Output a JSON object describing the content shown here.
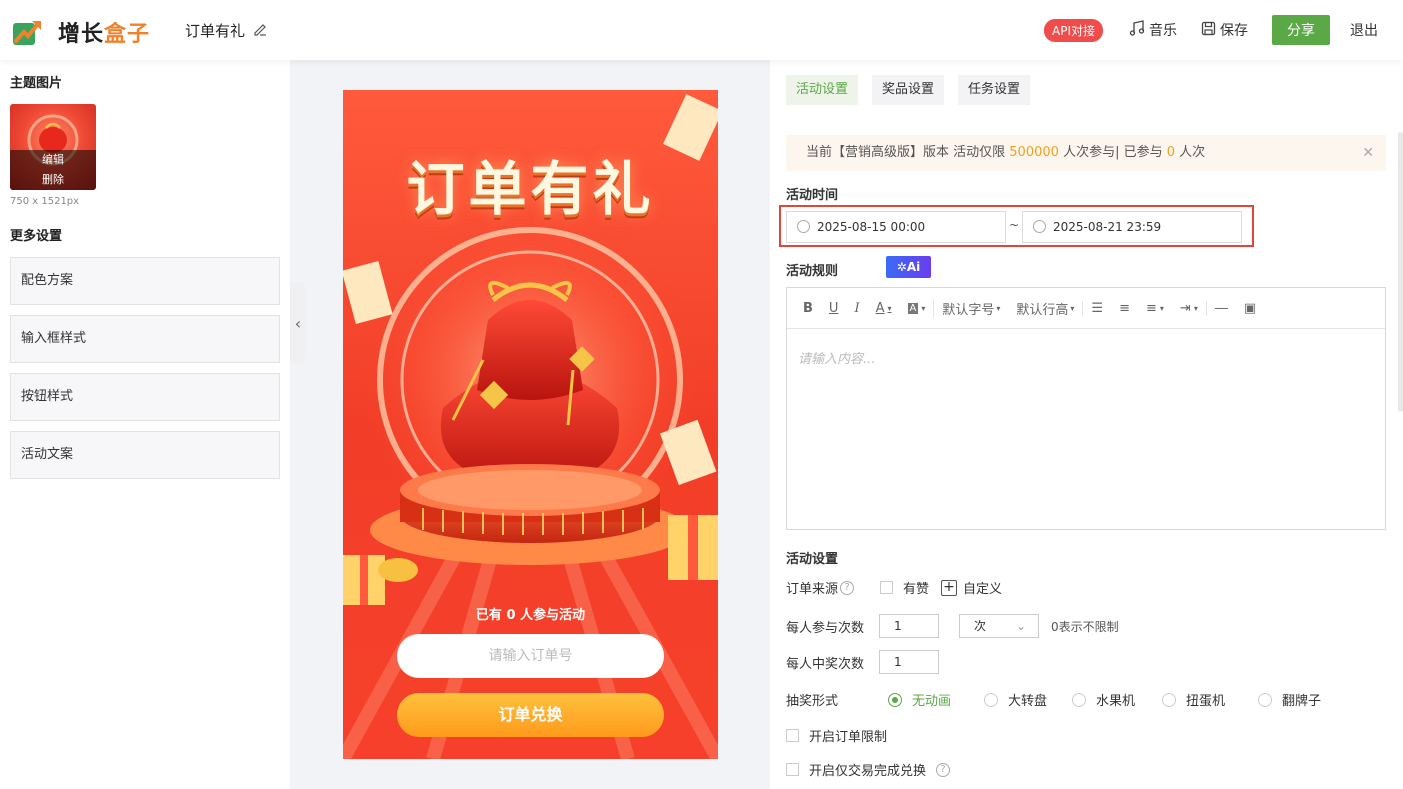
{
  "app": {
    "logo_part1": "增长",
    "logo_part2": "盒子",
    "page_title": "订单有礼"
  },
  "topbar": {
    "api_badge": "API对接",
    "music": "音乐",
    "save": "保存",
    "share": "分享",
    "exit": "退出"
  },
  "left": {
    "theme_title": "主题图片",
    "edit": "编辑",
    "delete": "删除",
    "image_size": "750 x 1521px",
    "more_title": "更多设置",
    "options": [
      "配色方案",
      "输入框样式",
      "按钮样式",
      "活动文案"
    ]
  },
  "phone": {
    "title": "订单有礼",
    "count_prefix": "已有",
    "count": "0",
    "count_suffix": "人参与活动",
    "input_placeholder": "请输入订单号",
    "button": "订单兑换"
  },
  "right": {
    "tabs": [
      "活动设置",
      "奖品设置",
      "任务设置"
    ],
    "notice_prefix": "当前【营销高级版】版本 活动仅限",
    "notice_limit": "500000",
    "notice_mid": "人次参与| 已参与",
    "notice_joined": "0",
    "notice_suffix": "人次",
    "time_label": "活动时间",
    "start_time": "2025-08-15 00:00",
    "separator": "~",
    "end_time": "2025-08-21 23:59",
    "rules_label": "活动规则",
    "ai_label": "Ai",
    "toolbar": {
      "font_size": "默认字号",
      "line_height": "默认行高"
    },
    "editor_placeholder": "请输入内容...",
    "settings_label": "活动设置",
    "order_source_label": "订单来源",
    "order_source_option": "有赞",
    "custom_label": "自定义",
    "per_join_label": "每人参与次数",
    "per_join_value": "1",
    "per_join_unit": "次",
    "per_join_hint": "0表示不限制",
    "per_win_label": "每人中奖次数",
    "per_win_value": "1",
    "draw_label": "抽奖形式",
    "draw_options": [
      "无动画",
      "大转盘",
      "水果机",
      "扭蛋机",
      "翻牌子"
    ],
    "order_limit_label": "开启订单限制",
    "trade_complete_label": "开启仅交易完成兑换"
  }
}
